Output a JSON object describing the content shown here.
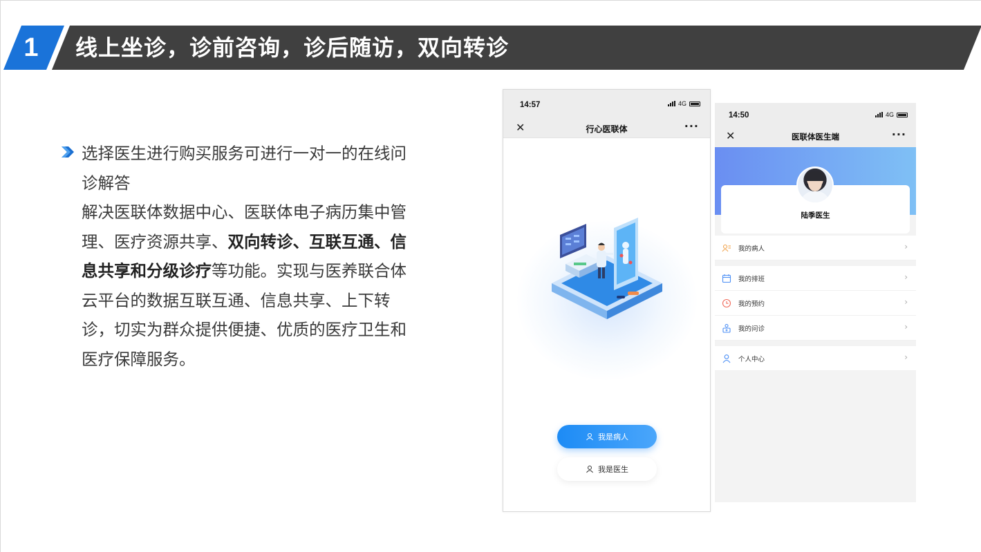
{
  "banner": {
    "number": "1",
    "title": "线上坐诊，诊前咨询，诊后随访，双向转诊"
  },
  "body": {
    "p1": "选择医生进行购买服务可进行一对一的在线问诊解答",
    "p2_normal_1": "解决医联体数据中心、医联体电子病历集中管理、医疗资源共享、",
    "p2_bold": "双向转诊、互联互通、信息共享和分级诊疗",
    "p2_normal_2": "等功能。实现与医养联合体云平台的数据互联互通、信息共享、上下转诊，切实为群众提供便捷、优质的医疗卫生和医疗保障服务。"
  },
  "phone1": {
    "time": "14:57",
    "network": "4G",
    "title": "行心医联体",
    "close_icon": "close-icon",
    "more_icon": "more-icon",
    "btn_patient": "我是病人",
    "btn_doctor": "我是医生",
    "accent": "#1d8bf5"
  },
  "phone2": {
    "time": "14:50",
    "network": "4G",
    "title": "医联体医生端",
    "doctor_name": "陆季医生",
    "menu": [
      {
        "label": "我的病人",
        "icon": "patients-icon",
        "color": "#f0a24a"
      },
      {
        "label": "我的排班",
        "icon": "calendar-icon",
        "color": "#4a8ef5"
      },
      {
        "label": "我的预约",
        "icon": "clock-icon",
        "color": "#f06a5a"
      },
      {
        "label": "我的问诊",
        "icon": "consult-icon",
        "color": "#4a8ef5"
      },
      {
        "label": "个人中心",
        "icon": "user-icon",
        "color": "#4a8ef5"
      }
    ],
    "arrow": "›"
  }
}
